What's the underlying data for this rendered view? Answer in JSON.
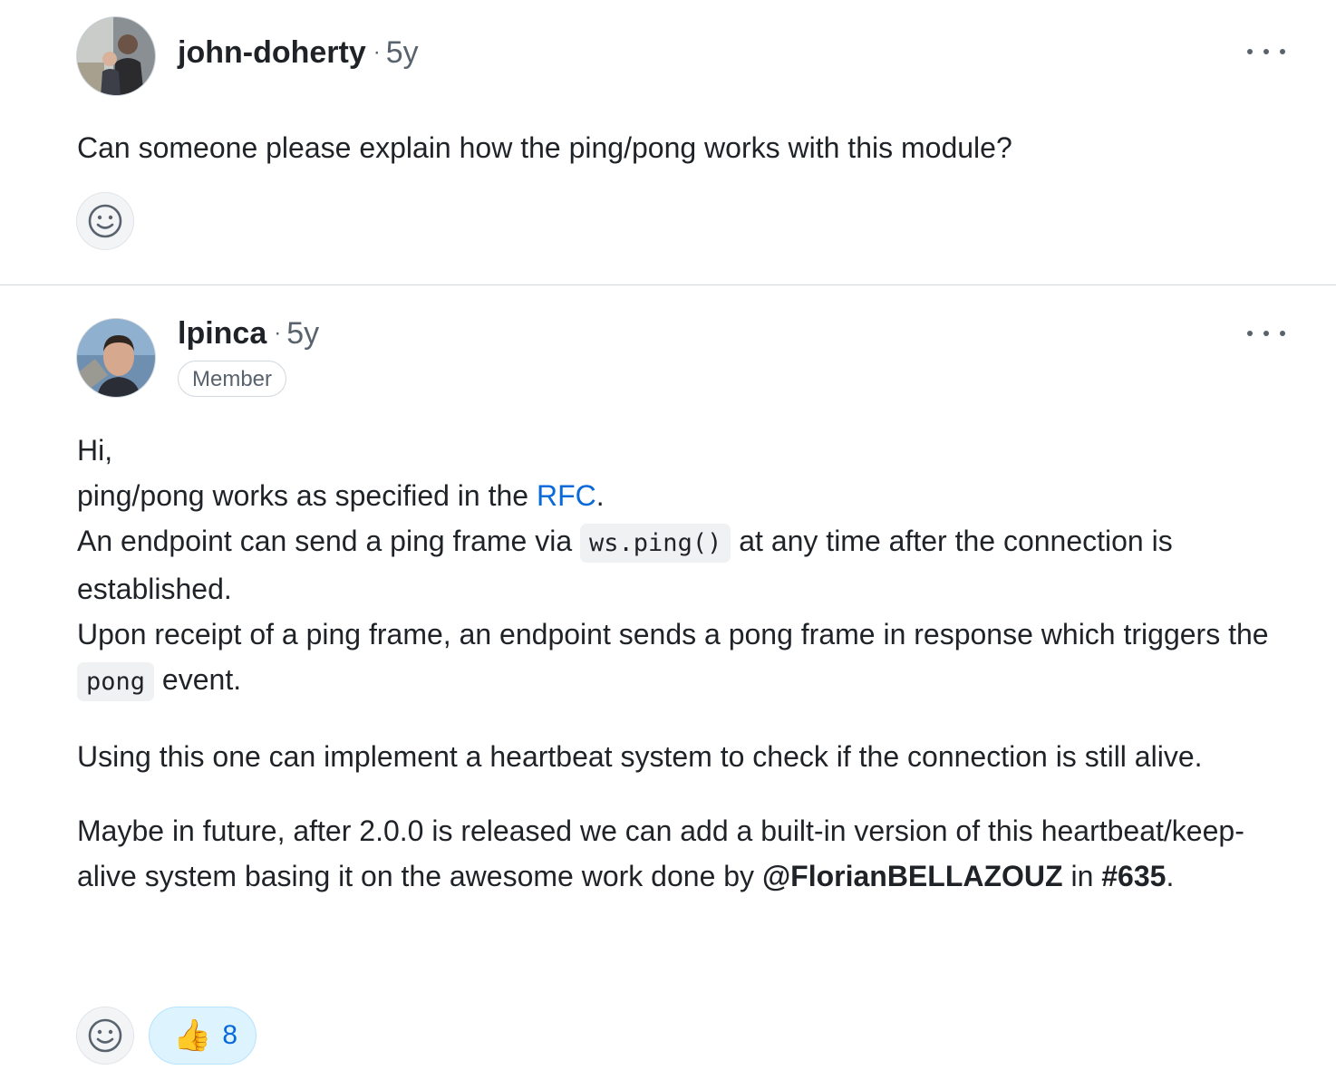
{
  "comments": [
    {
      "author": "john-doherty",
      "separator": "·",
      "time": "5y",
      "avatar_icon": "avatar-photo",
      "menu_icon": "kebab-horizontal-icon",
      "body": {
        "p1": "Can someone please explain how the ping/pong works with this module?"
      },
      "reactions": {
        "add_icon": "smiley-icon"
      }
    },
    {
      "author": "lpinca",
      "separator": "·",
      "time": "5y",
      "badge": "Member",
      "avatar_icon": "avatar-photo",
      "menu_icon": "kebab-horizontal-icon",
      "body": {
        "line1": "Hi,",
        "line2_pre": "ping/pong works as specified in the ",
        "line2_link": "RFC",
        "line2_post": ".",
        "line3_pre": "An endpoint can send a ping frame via ",
        "line3_code": "ws.ping()",
        "line3_post": " at any time after the connection is established.",
        "line4_pre": "Upon receipt of a ping frame, an endpoint sends a pong frame in response which triggers the ",
        "line4_code": "pong",
        "line4_post": " event.",
        "p2": "Using this one can implement a heartbeat system to check if the connection is still alive.",
        "p3_pre": "Maybe in future, after 2.0.0 is released we can add a built-in version of this heartbeat/keep-alive system basing it on the awesome work done by ",
        "p3_mention": "@FlorianBELLAZOUZ",
        "p3_mid": " in ",
        "p3_issue": "#635",
        "p3_post": "."
      },
      "reactions": {
        "add_icon": "smiley-icon",
        "thumbs_up_emoji": "👍",
        "thumbs_up_count": "8"
      }
    }
  ],
  "colors": {
    "link": "#0969da",
    "muted": "#59636e",
    "reaction_active_bg": "#ddf4ff"
  }
}
